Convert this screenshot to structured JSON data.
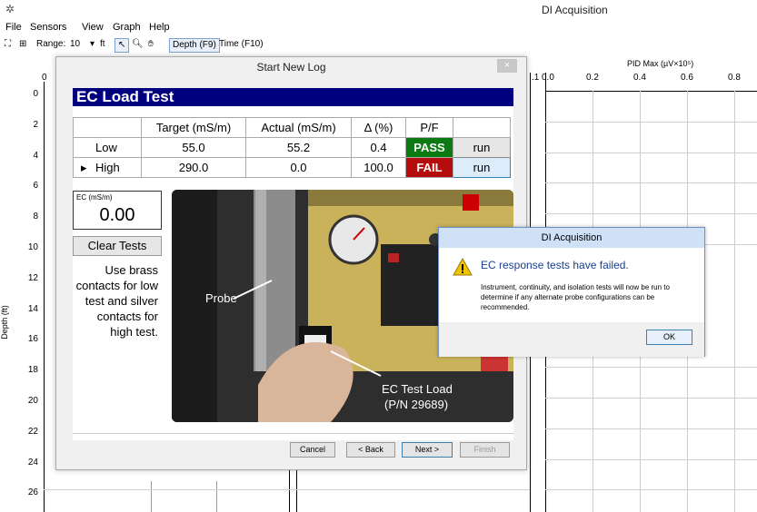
{
  "window": {
    "title": "DI Acquisition"
  },
  "menu": [
    "File",
    "Sensors",
    "View",
    "Graph",
    "Help"
  ],
  "toolbar": {
    "range_label": "Range:",
    "range_value": "10",
    "range_unit": "ft",
    "depth_btn": "Depth (F9)",
    "time_btn": "Time (F10)"
  },
  "plot": {
    "depth_axis_label": "Depth (ft)",
    "depth_ticks": [
      "0",
      "2",
      "4",
      "6",
      "8",
      "10",
      "12",
      "14",
      "16",
      "18",
      "20",
      "22",
      "24",
      "26"
    ],
    "top_left_tick": "0",
    "pid_label": "PID Max (µV×10⁵)",
    "pid_ticks": [
      ".1",
      "0.0",
      "0.2",
      "0.4",
      "0.6",
      "0.8"
    ]
  },
  "dialog": {
    "title": "Start New Log",
    "close": "×",
    "heading": "EC Load Test",
    "table": {
      "headers": [
        "",
        "Target (mS/m)",
        "Actual (mS/m)",
        "Δ (%)",
        "P/F",
        ""
      ],
      "rows": [
        {
          "marker": "",
          "name": "Low",
          "target": "55.0",
          "actual": "55.2",
          "delta": "0.4",
          "pf": "PASS",
          "run": "run"
        },
        {
          "marker": "▸",
          "name": "High",
          "target": "290.0",
          "actual": "0.0",
          "delta": "100.0",
          "pf": "FAIL",
          "run": "run"
        }
      ]
    },
    "ec_label": "EC (mS/m)",
    "ec_value": "0.00",
    "clear_button": "Clear Tests",
    "instructions": "Use brass contacts for low test and silver contacts for high test.",
    "photo": {
      "probe_label": "Probe",
      "load_label_1": "EC Test Load",
      "load_label_2": "(P/N 29689)"
    },
    "buttons": {
      "cancel": "Cancel",
      "back": "< Back",
      "next": "Next >",
      "finish": "Finish"
    }
  },
  "message_box": {
    "title": "DI Acquisition",
    "heading": "EC response tests have failed.",
    "body": "Instrument, continuity, and isolation tests will now be run to determine if any alternate probe configurations can be recommended.",
    "ok": "OK"
  }
}
